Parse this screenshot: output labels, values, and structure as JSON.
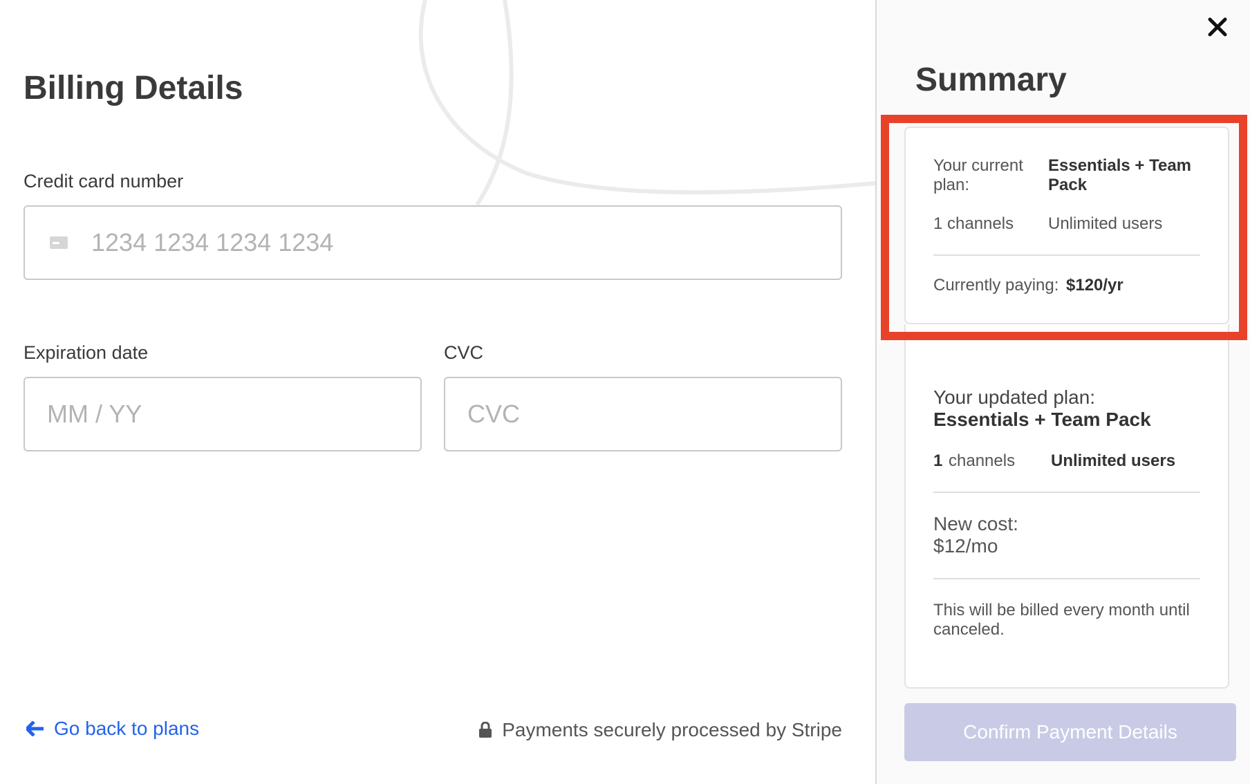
{
  "billing": {
    "title": "Billing Details",
    "card_label": "Credit card number",
    "card_placeholder": "1234 1234 1234 1234",
    "exp_label": "Expiration date",
    "exp_placeholder": "MM / YY",
    "cvc_label": "CVC",
    "cvc_placeholder": "CVC",
    "back_link": "Go back to plans",
    "stripe_note": "Payments securely processed by Stripe"
  },
  "summary": {
    "title": "Summary",
    "current": {
      "plan_label": "Your current plan:",
      "plan_name": "Essentials + Team Pack",
      "channels": "1 channels",
      "users": "Unlimited users",
      "paying_label": "Currently paying:",
      "paying_value": "$120/yr"
    },
    "updated": {
      "plan_label": "Your updated plan:",
      "plan_name": "Essentials + Team Pack",
      "channels_count": "1",
      "channels_label": "channels",
      "users": "Unlimited users",
      "cost_label": "New cost:",
      "cost_value": "$12/mo",
      "billing_note": "This will be billed every month until canceled."
    },
    "confirm_button": "Confirm Payment Details"
  },
  "colors": {
    "highlight": "#e8422b",
    "link": "#2463eb",
    "button_disabled": "#c9cbe6"
  },
  "icons": [
    "card-icon",
    "arrow-left-icon",
    "lock-icon",
    "close-icon"
  ]
}
